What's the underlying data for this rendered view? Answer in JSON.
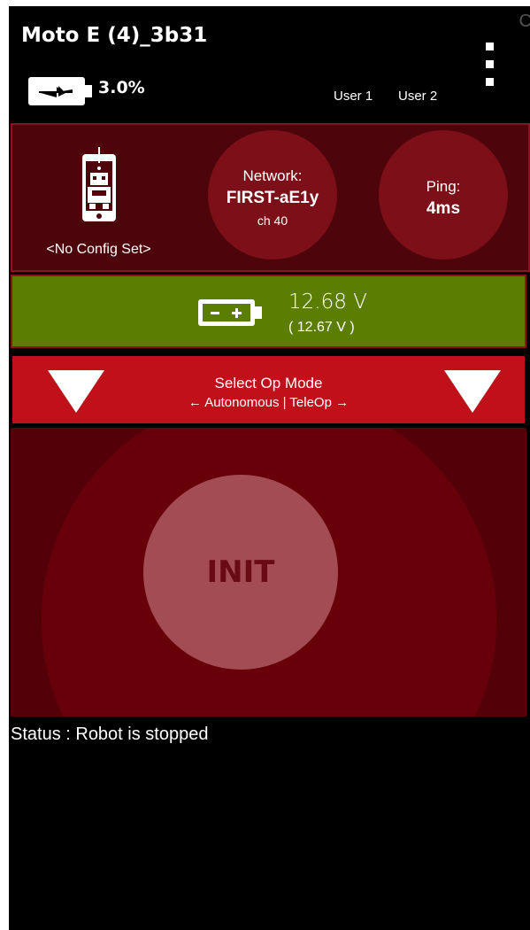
{
  "header": {
    "device_name": "Moto E (4)_3b31",
    "corner_char": "C",
    "battery_percent": "3.0%",
    "user1": "User 1",
    "user2": "User 2",
    "menu_icon": "overflow-menu-icon"
  },
  "robot_status": {
    "config": "<No Config Set>",
    "network_label": "Network:",
    "network_name": "FIRST-aE1y",
    "channel": "ch 40",
    "ping_label": "Ping:",
    "ping_value": "4ms"
  },
  "battery": {
    "voltage": "12.68 V",
    "voltage_min": "( 12.67 V )",
    "bar_color": "#5b7d02"
  },
  "opmode": {
    "title": "Select Op Mode",
    "subtitle": "← Autonomous | TeleOp →"
  },
  "init": {
    "label": "INIT"
  },
  "status": {
    "text": "Status : Robot is stopped"
  },
  "colors": {
    "accent_red": "#c0101a",
    "dark_red": "#4d040b",
    "circle_red": "#7c0f17",
    "init_button": "#a34c54"
  }
}
